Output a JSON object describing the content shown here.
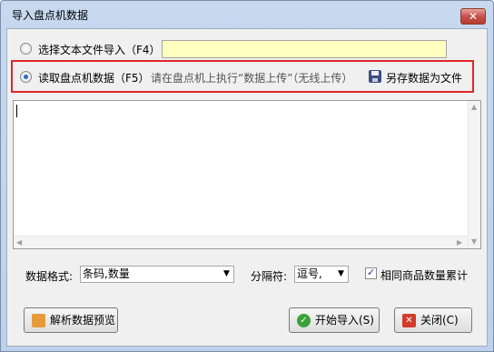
{
  "window": {
    "title": "导入盘点机数据",
    "close_glyph": "✕"
  },
  "row1": {
    "radio_label": "选择文本文件导入（F4）",
    "file_path": ""
  },
  "row2": {
    "radio_label": "读取盘点机数据（F5）",
    "hint": "请在盘点机上执行“数据上传”（无线上传）",
    "save_label": "另存数据为文件"
  },
  "textarea": {
    "content": ""
  },
  "options": {
    "format_label": "数据格式:",
    "format_value": "条码,数量",
    "separator_label": "分隔符:",
    "separator_value": "逗号,",
    "merge_label": "相同商品数量累计",
    "merge_checked": true
  },
  "buttons": {
    "preview": "解析数据预览",
    "start": "开始导入(S)",
    "close": "关闭(C)"
  },
  "colors": {
    "highlight": "#e0262a",
    "file_input_bg": "#ffffc0"
  }
}
